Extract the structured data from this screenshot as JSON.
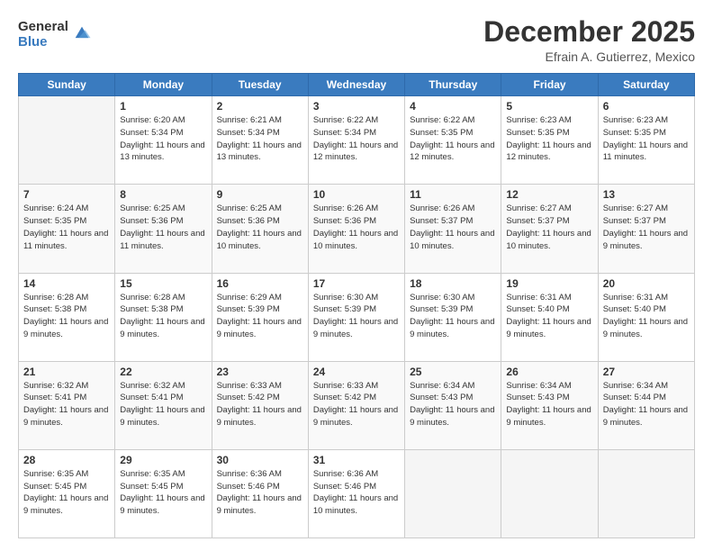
{
  "logo": {
    "general": "General",
    "blue": "Blue"
  },
  "header": {
    "month": "December 2025",
    "subtitle": "Efrain A. Gutierrez, Mexico"
  },
  "days_of_week": [
    "Sunday",
    "Monday",
    "Tuesday",
    "Wednesday",
    "Thursday",
    "Friday",
    "Saturday"
  ],
  "weeks": [
    [
      {
        "day": "",
        "empty": true
      },
      {
        "day": "1",
        "sunrise": "Sunrise: 6:20 AM",
        "sunset": "Sunset: 5:34 PM",
        "daylight": "Daylight: 11 hours and 13 minutes."
      },
      {
        "day": "2",
        "sunrise": "Sunrise: 6:21 AM",
        "sunset": "Sunset: 5:34 PM",
        "daylight": "Daylight: 11 hours and 13 minutes."
      },
      {
        "day": "3",
        "sunrise": "Sunrise: 6:22 AM",
        "sunset": "Sunset: 5:34 PM",
        "daylight": "Daylight: 11 hours and 12 minutes."
      },
      {
        "day": "4",
        "sunrise": "Sunrise: 6:22 AM",
        "sunset": "Sunset: 5:35 PM",
        "daylight": "Daylight: 11 hours and 12 minutes."
      },
      {
        "day": "5",
        "sunrise": "Sunrise: 6:23 AM",
        "sunset": "Sunset: 5:35 PM",
        "daylight": "Daylight: 11 hours and 12 minutes."
      },
      {
        "day": "6",
        "sunrise": "Sunrise: 6:23 AM",
        "sunset": "Sunset: 5:35 PM",
        "daylight": "Daylight: 11 hours and 11 minutes."
      }
    ],
    [
      {
        "day": "7",
        "sunrise": "Sunrise: 6:24 AM",
        "sunset": "Sunset: 5:35 PM",
        "daylight": "Daylight: 11 hours and 11 minutes."
      },
      {
        "day": "8",
        "sunrise": "Sunrise: 6:25 AM",
        "sunset": "Sunset: 5:36 PM",
        "daylight": "Daylight: 11 hours and 11 minutes."
      },
      {
        "day": "9",
        "sunrise": "Sunrise: 6:25 AM",
        "sunset": "Sunset: 5:36 PM",
        "daylight": "Daylight: 11 hours and 10 minutes."
      },
      {
        "day": "10",
        "sunrise": "Sunrise: 6:26 AM",
        "sunset": "Sunset: 5:36 PM",
        "daylight": "Daylight: 11 hours and 10 minutes."
      },
      {
        "day": "11",
        "sunrise": "Sunrise: 6:26 AM",
        "sunset": "Sunset: 5:37 PM",
        "daylight": "Daylight: 11 hours and 10 minutes."
      },
      {
        "day": "12",
        "sunrise": "Sunrise: 6:27 AM",
        "sunset": "Sunset: 5:37 PM",
        "daylight": "Daylight: 11 hours and 10 minutes."
      },
      {
        "day": "13",
        "sunrise": "Sunrise: 6:27 AM",
        "sunset": "Sunset: 5:37 PM",
        "daylight": "Daylight: 11 hours and 9 minutes."
      }
    ],
    [
      {
        "day": "14",
        "sunrise": "Sunrise: 6:28 AM",
        "sunset": "Sunset: 5:38 PM",
        "daylight": "Daylight: 11 hours and 9 minutes."
      },
      {
        "day": "15",
        "sunrise": "Sunrise: 6:28 AM",
        "sunset": "Sunset: 5:38 PM",
        "daylight": "Daylight: 11 hours and 9 minutes."
      },
      {
        "day": "16",
        "sunrise": "Sunrise: 6:29 AM",
        "sunset": "Sunset: 5:39 PM",
        "daylight": "Daylight: 11 hours and 9 minutes."
      },
      {
        "day": "17",
        "sunrise": "Sunrise: 6:30 AM",
        "sunset": "Sunset: 5:39 PM",
        "daylight": "Daylight: 11 hours and 9 minutes."
      },
      {
        "day": "18",
        "sunrise": "Sunrise: 6:30 AM",
        "sunset": "Sunset: 5:39 PM",
        "daylight": "Daylight: 11 hours and 9 minutes."
      },
      {
        "day": "19",
        "sunrise": "Sunrise: 6:31 AM",
        "sunset": "Sunset: 5:40 PM",
        "daylight": "Daylight: 11 hours and 9 minutes."
      },
      {
        "day": "20",
        "sunrise": "Sunrise: 6:31 AM",
        "sunset": "Sunset: 5:40 PM",
        "daylight": "Daylight: 11 hours and 9 minutes."
      }
    ],
    [
      {
        "day": "21",
        "sunrise": "Sunrise: 6:32 AM",
        "sunset": "Sunset: 5:41 PM",
        "daylight": "Daylight: 11 hours and 9 minutes."
      },
      {
        "day": "22",
        "sunrise": "Sunrise: 6:32 AM",
        "sunset": "Sunset: 5:41 PM",
        "daylight": "Daylight: 11 hours and 9 minutes."
      },
      {
        "day": "23",
        "sunrise": "Sunrise: 6:33 AM",
        "sunset": "Sunset: 5:42 PM",
        "daylight": "Daylight: 11 hours and 9 minutes."
      },
      {
        "day": "24",
        "sunrise": "Sunrise: 6:33 AM",
        "sunset": "Sunset: 5:42 PM",
        "daylight": "Daylight: 11 hours and 9 minutes."
      },
      {
        "day": "25",
        "sunrise": "Sunrise: 6:34 AM",
        "sunset": "Sunset: 5:43 PM",
        "daylight": "Daylight: 11 hours and 9 minutes."
      },
      {
        "day": "26",
        "sunrise": "Sunrise: 6:34 AM",
        "sunset": "Sunset: 5:43 PM",
        "daylight": "Daylight: 11 hours and 9 minutes."
      },
      {
        "day": "27",
        "sunrise": "Sunrise: 6:34 AM",
        "sunset": "Sunset: 5:44 PM",
        "daylight": "Daylight: 11 hours and 9 minutes."
      }
    ],
    [
      {
        "day": "28",
        "sunrise": "Sunrise: 6:35 AM",
        "sunset": "Sunset: 5:45 PM",
        "daylight": "Daylight: 11 hours and 9 minutes."
      },
      {
        "day": "29",
        "sunrise": "Sunrise: 6:35 AM",
        "sunset": "Sunset: 5:45 PM",
        "daylight": "Daylight: 11 hours and 9 minutes."
      },
      {
        "day": "30",
        "sunrise": "Sunrise: 6:36 AM",
        "sunset": "Sunset: 5:46 PM",
        "daylight": "Daylight: 11 hours and 9 minutes."
      },
      {
        "day": "31",
        "sunrise": "Sunrise: 6:36 AM",
        "sunset": "Sunset: 5:46 PM",
        "daylight": "Daylight: 11 hours and 10 minutes."
      },
      {
        "day": "",
        "empty": true
      },
      {
        "day": "",
        "empty": true
      },
      {
        "day": "",
        "empty": true
      }
    ]
  ]
}
